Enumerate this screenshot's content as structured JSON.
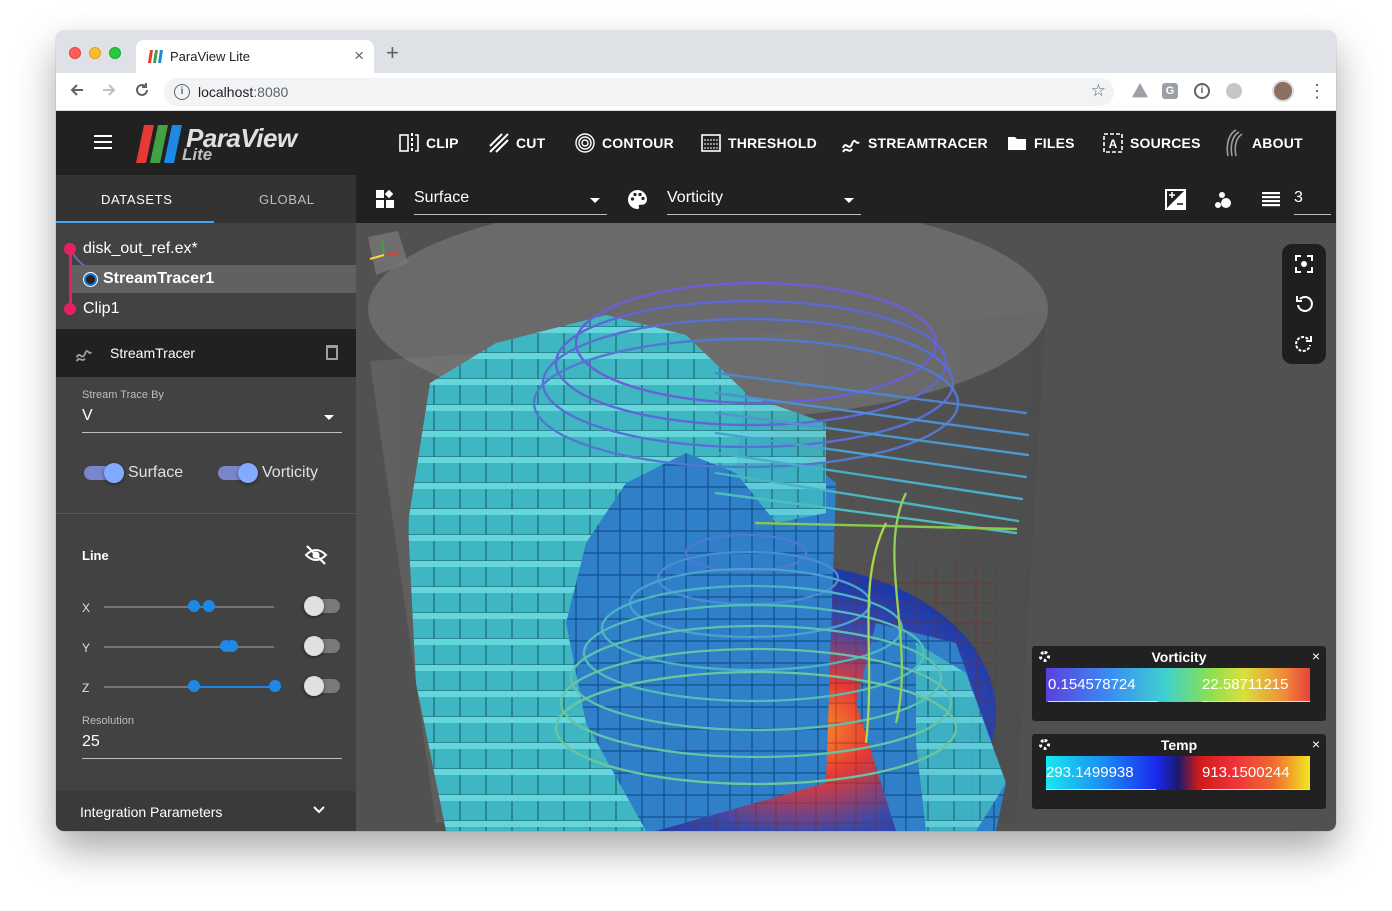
{
  "browser": {
    "tab_title": "ParaView Lite",
    "tab_close": "×",
    "new_tab": "+",
    "url_host": "localhost",
    "url_port": ":8080",
    "ext_g": "G",
    "ext_i": "i"
  },
  "app": {
    "logo_main": "ParaView",
    "logo_sub": "Lite",
    "header_buttons": [
      {
        "label": "CLIP",
        "icon": "clip-icon"
      },
      {
        "label": "CUT",
        "icon": "cut-icon"
      },
      {
        "label": "CONTOUR",
        "icon": "contour-icon"
      },
      {
        "label": "THRESHOLD",
        "icon": "threshold-icon"
      },
      {
        "label": "STREAMTRACER",
        "icon": "streamtracer-icon"
      },
      {
        "label": "FILES",
        "icon": "folder-icon"
      },
      {
        "label": "SOURCES",
        "icon": "sources-icon"
      },
      {
        "label": "ABOUT",
        "icon": "about-icon"
      }
    ]
  },
  "panel": {
    "tabs": [
      "DATASETS",
      "GLOBAL"
    ],
    "pipeline": [
      "disk_out_ref.ex*",
      "StreamTracer1",
      "Clip1"
    ],
    "source_title": "StreamTracer",
    "stream_trace_by_label": "Stream Trace By",
    "stream_trace_by_value": "V",
    "toggle_surface": "Surface",
    "toggle_vorticity": "Vorticity",
    "line_title": "Line",
    "axes": [
      "X",
      "Y",
      "Z"
    ],
    "resolution_label": "Resolution",
    "resolution_value": "25",
    "integration_params": "Integration Parameters"
  },
  "viewport_toolbar": {
    "representation": "Surface",
    "color_by": "Vorticity",
    "layer_count": "3"
  },
  "luts": [
    {
      "title": "Vorticity",
      "min": "0.154578724",
      "max": "22.58711215",
      "close": "×"
    },
    {
      "title": "Temp",
      "min": "293.1499938",
      "max": "913.1500244",
      "close": "×"
    }
  ],
  "colors": {
    "pipeline_accent": "#e91e63",
    "primary_blue": "#1e88e5",
    "header_bg": "#212121",
    "panel_bg": "#424242"
  }
}
